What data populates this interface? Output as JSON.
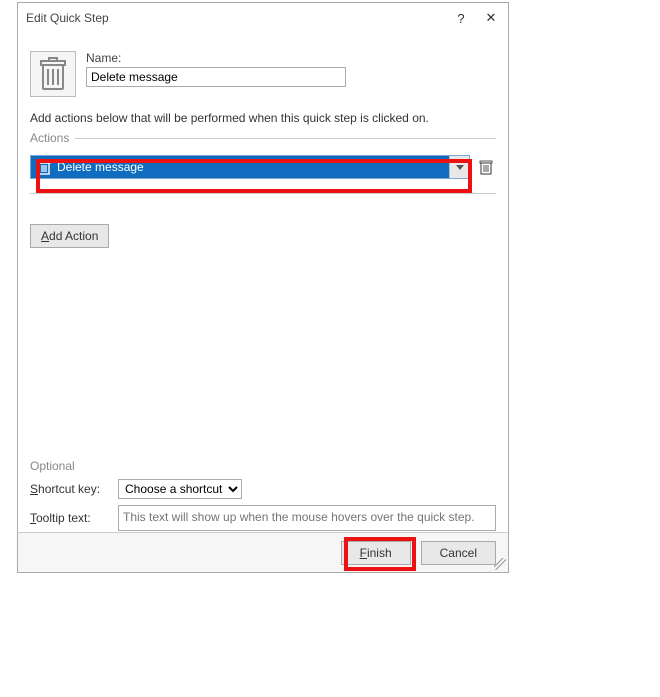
{
  "titlebar": {
    "title": "Edit Quick Step",
    "help": "?",
    "close": "✕"
  },
  "name": {
    "label": "Name:",
    "value": "Delete message"
  },
  "description": "Add actions below that will be performed when this quick step is clicked on.",
  "sections": {
    "actions": "Actions",
    "optional": "Optional"
  },
  "action": {
    "selected": "Delete message",
    "dropdown_arrow": "▾"
  },
  "add_action": {
    "prefix": "A",
    "rest": "dd Action"
  },
  "shortcut": {
    "label_prefix": "S",
    "label_rest": "hortcut key:",
    "value": "Choose a shortcut"
  },
  "tooltip": {
    "label_prefix": "T",
    "label_rest": "ooltip text:",
    "placeholder": "This text will show up when the mouse hovers over the quick step."
  },
  "buttons": {
    "finish_prefix": "F",
    "finish_rest": "inish",
    "cancel": "Cancel"
  }
}
